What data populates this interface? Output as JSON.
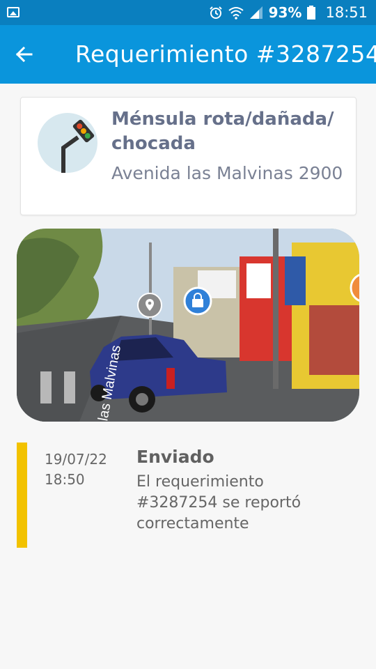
{
  "status_bar": {
    "battery": "93%",
    "time": "18:51",
    "icons": [
      "gallery-icon",
      "alarm-icon",
      "wifi-icon",
      "signal-icon",
      "battery-icon"
    ]
  },
  "app_bar": {
    "title": "Requerimiento #3287254",
    "back_icon": "arrow-back-icon"
  },
  "request_card": {
    "icon": "traffic-light-icon",
    "title": "Ménsula rota/dañada/ chocada",
    "address": "Avenida las Malvinas 2900"
  },
  "photo": {
    "street_label": "las Malvinas",
    "markers": [
      "location-pin-icon",
      "shopping-bag-icon"
    ]
  },
  "timeline": [
    {
      "date": "19/07/22",
      "time": "18:50",
      "status": "Enviado",
      "message": "El requerimiento #3287254 se reportó correctamente",
      "color": "#f2c200"
    }
  ],
  "colors": {
    "status_bar": "#0a7fbf",
    "app_bar": "#0a95dc",
    "title_text": "#66708a",
    "timeline_accent": "#f2c200"
  }
}
